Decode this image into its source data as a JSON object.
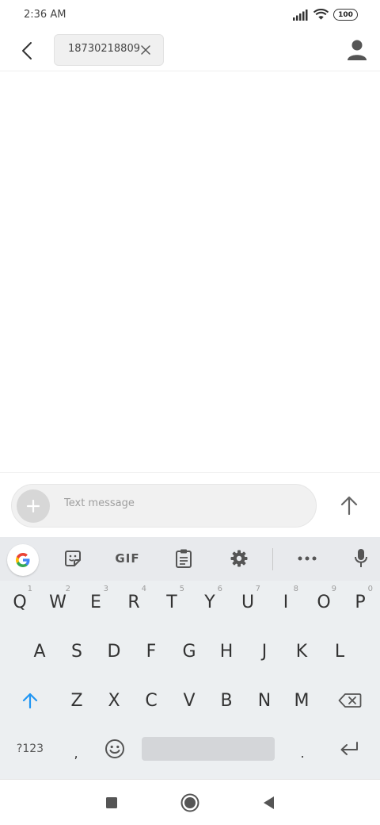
{
  "status_bar": {
    "time": "2:36 AM",
    "battery": "100"
  },
  "header": {
    "recipient": "18730218809"
  },
  "compose": {
    "placeholder": "Text message"
  },
  "keyboard": {
    "toolbar": {
      "gif_label": "GIF"
    },
    "rows": [
      {
        "keys": [
          {
            "label": "Q",
            "hint": "1"
          },
          {
            "label": "W",
            "hint": "2"
          },
          {
            "label": "E",
            "hint": "3"
          },
          {
            "label": "R",
            "hint": "4"
          },
          {
            "label": "T",
            "hint": "5"
          },
          {
            "label": "Y",
            "hint": "6"
          },
          {
            "label": "U",
            "hint": "7"
          },
          {
            "label": "I",
            "hint": "8"
          },
          {
            "label": "O",
            "hint": "9"
          },
          {
            "label": "P",
            "hint": "0"
          }
        ]
      },
      {
        "keys": [
          {
            "label": "A"
          },
          {
            "label": "S"
          },
          {
            "label": "D"
          },
          {
            "label": "F"
          },
          {
            "label": "G"
          },
          {
            "label": "H"
          },
          {
            "label": "J"
          },
          {
            "label": "K"
          },
          {
            "label": "L"
          }
        ]
      },
      {
        "keys": [
          {
            "label": "Z"
          },
          {
            "label": "X"
          },
          {
            "label": "C"
          },
          {
            "label": "V"
          },
          {
            "label": "B"
          },
          {
            "label": "N"
          },
          {
            "label": "M"
          }
        ]
      }
    ],
    "symbols_label": "?123",
    "comma_label": ",",
    "period_label": "."
  },
  "colors": {
    "shift_accent": "#2196f3",
    "keyboard_bg": "#eceff1"
  },
  "icons": [
    "back-icon",
    "close-icon",
    "person-icon",
    "plus-icon",
    "send-arrow-icon",
    "google-icon",
    "sticker-icon",
    "clipboard-icon",
    "gear-icon",
    "more-icon",
    "mic-icon",
    "shift-icon",
    "backspace-icon",
    "emoji-icon",
    "enter-icon",
    "recents-icon",
    "home-icon",
    "back-triangle-icon"
  ]
}
